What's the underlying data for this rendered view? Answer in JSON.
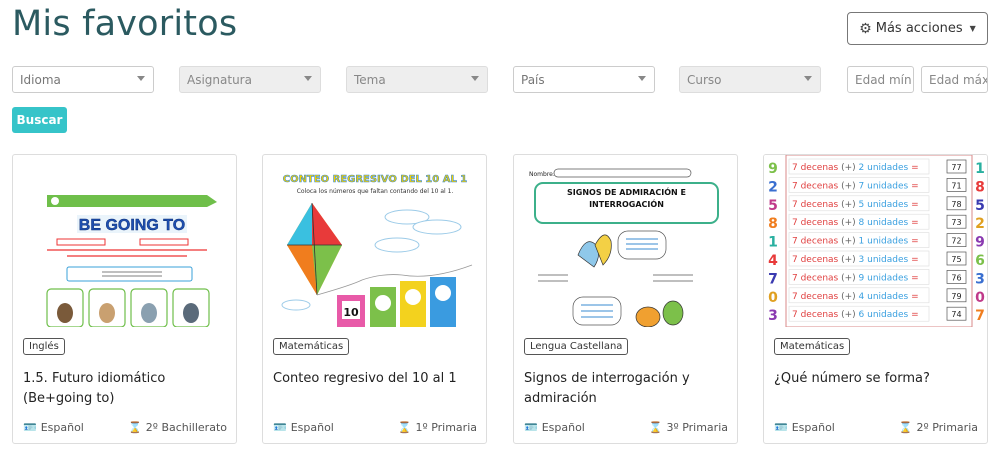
{
  "page": {
    "title": "Mis favoritos"
  },
  "actions": {
    "more_label": "Más acciones"
  },
  "filters": {
    "idioma": "Idioma",
    "asignatura": "Asignatura",
    "tema": "Tema",
    "pais": "País",
    "curso": "Curso",
    "edad_min": "Edad mín",
    "edad_max": "Edad máx"
  },
  "search": {
    "label": "Buscar"
  },
  "cards": [
    {
      "subject": "Inglés",
      "title": "1.5. Futuro idiomático (Be+going to)",
      "language": "Español",
      "level": "2º Bachillerato",
      "thumb": {
        "header": "BE GOING TO"
      }
    },
    {
      "subject": "Matemáticas",
      "title": "Conteo regresivo del 10 al 1",
      "language": "Español",
      "level": "1º Primaria",
      "thumb": {
        "header": "CONTEO REGRESIVO DEL 10 AL 1",
        "subheader": "Coloca los números que faltan contando del 10 al 1.",
        "number": "10"
      }
    },
    {
      "subject": "Lengua Castellana",
      "title": "Signos de interrogación y admiración",
      "language": "Español",
      "level": "3º Primaria",
      "thumb": {
        "name_label": "Nombre:",
        "header": "SIGNOS DE ADMIRACIÓN E INTERROGACIÓN"
      }
    },
    {
      "subject": "Matemáticas",
      "title": "¿Qué número se forma?",
      "language": "Español",
      "level": "2º Primaria",
      "thumb": {
        "rows": [
          {
            "d": "7",
            "u": "2",
            "r": "77"
          },
          {
            "d": "7",
            "u": "7",
            "r": "71"
          },
          {
            "d": "7",
            "u": "5",
            "r": "78"
          },
          {
            "d": "7",
            "u": "8",
            "r": "73"
          },
          {
            "d": "7",
            "u": "1",
            "r": "72"
          },
          {
            "d": "7",
            "u": "3",
            "r": "75"
          },
          {
            "d": "7",
            "u": "9",
            "r": "76"
          },
          {
            "d": "7",
            "u": "4",
            "r": "79"
          },
          {
            "d": "7",
            "u": "6",
            "r": "74"
          }
        ],
        "decenas_word": "decenas",
        "unidades_word": "unidades"
      }
    }
  ]
}
